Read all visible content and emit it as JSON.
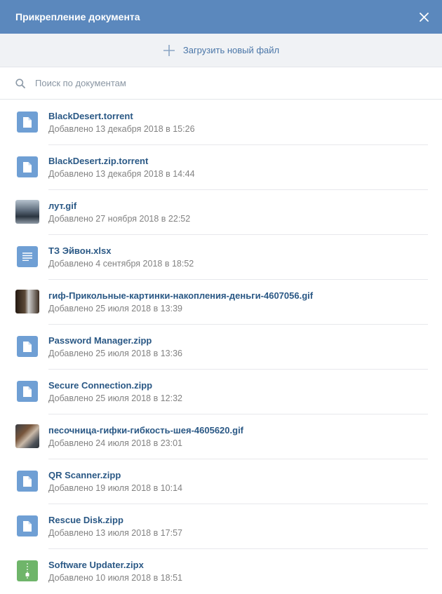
{
  "header": {
    "title": "Прикрепление документа"
  },
  "upload": {
    "label": "Загрузить новый файл"
  },
  "search": {
    "placeholder": "Поиск по документам"
  },
  "colors": {
    "header_bg": "#5b88bd",
    "link": "#2a5885",
    "doc_icon": "#6f9fd4",
    "zip_icon": "#6fb56a"
  },
  "documents": [
    {
      "name": "BlackDesert.torrent",
      "date": "Добавлено 13 декабря 2018 в 15:26",
      "icon": "document-icon"
    },
    {
      "name": "BlackDesert.zip.torrent",
      "date": "Добавлено 13 декабря 2018 в 14:44",
      "icon": "document-icon"
    },
    {
      "name": "лут.gif",
      "date": "Добавлено 27 ноября 2018 в 22:52",
      "icon": "image-thumbnail"
    },
    {
      "name": "ТЗ Эйвон.xlsx",
      "date": "Добавлено 4 сентября 2018 в 18:52",
      "icon": "text-document-icon"
    },
    {
      "name": "гиф-Прикольные-картинки-накопления-деньги-4607056.gif",
      "date": "Добавлено 25 июля 2018 в 13:39",
      "icon": "image-thumbnail"
    },
    {
      "name": "Password Manager.zipp",
      "date": "Добавлено 25 июля 2018 в 13:36",
      "icon": "document-icon"
    },
    {
      "name": "Secure Connection.zipp",
      "date": "Добавлено 25 июля 2018 в 12:32",
      "icon": "document-icon"
    },
    {
      "name": "песочница-гифки-гибкость-шея-4605620.gif",
      "date": "Добавлено 24 июля 2018 в 23:01",
      "icon": "image-thumbnail"
    },
    {
      "name": "QR Scanner.zipp",
      "date": "Добавлено 19 июля 2018 в 10:14",
      "icon": "document-icon"
    },
    {
      "name": "Rescue Disk.zipp",
      "date": "Добавлено 13 июля 2018 в 17:57",
      "icon": "document-icon"
    },
    {
      "name": "Software Updater.zipx",
      "date": "Добавлено 10 июля 2018 в 18:51",
      "icon": "archive-icon"
    }
  ]
}
